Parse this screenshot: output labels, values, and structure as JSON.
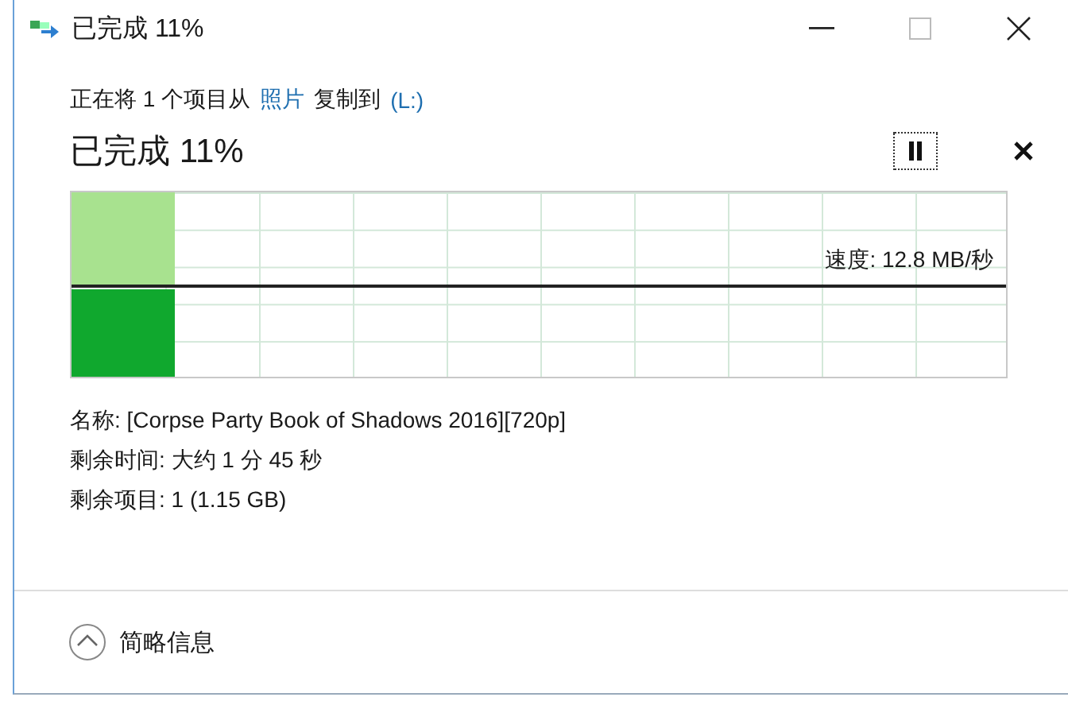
{
  "window": {
    "title": "已完成 11%"
  },
  "copy_line": {
    "prefix": "正在将 1 个项目从",
    "source": "照片",
    "middle": "复制到",
    "destination": "(L:)"
  },
  "heading": "已完成 11%",
  "progress": {
    "level": 0.11,
    "speed": "速度: 12.8 MB/秒"
  },
  "details": [
    "名称: [Corpse Party Book of Shadows 2016][720p]",
    "剩余时间: 大约 1 分 45 秒",
    "剩余项目: 1 (1.15 GB)"
  ],
  "footer": {
    "label": "简略信息"
  }
}
